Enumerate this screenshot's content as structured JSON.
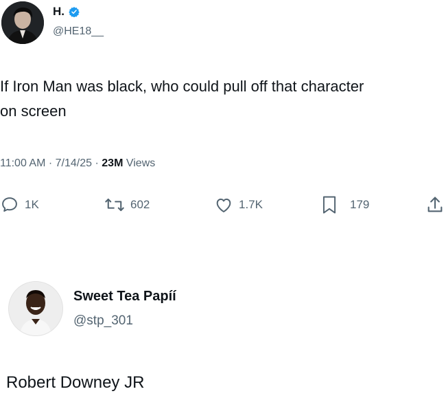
{
  "tweet": {
    "author": {
      "name": "H.",
      "handle": "@HE18__",
      "verified": true
    },
    "text_line1": "If Iron Man was black, who could pull off that character",
    "text_line2": "on screen",
    "time": "11:00 AM",
    "date": "7/14/25",
    "views_count": "23M",
    "views_label": "Views",
    "meta_sep": "·"
  },
  "actions": {
    "reply": {
      "icon": "reply-icon",
      "count": "1K"
    },
    "retweet": {
      "icon": "retweet-icon",
      "count": "602"
    },
    "like": {
      "icon": "heart-icon",
      "count": "1.7K"
    },
    "bookmark": {
      "icon": "bookmark-icon",
      "count": "179"
    },
    "share": {
      "icon": "share-icon"
    }
  },
  "reply": {
    "author": {
      "name": "Sweet Tea Papíí",
      "handle": "@stp_301"
    },
    "text": "Robert Downey JR"
  },
  "colors": {
    "text": "#0f1419",
    "secondary": "#536471",
    "verified": "#1d9bf0"
  }
}
